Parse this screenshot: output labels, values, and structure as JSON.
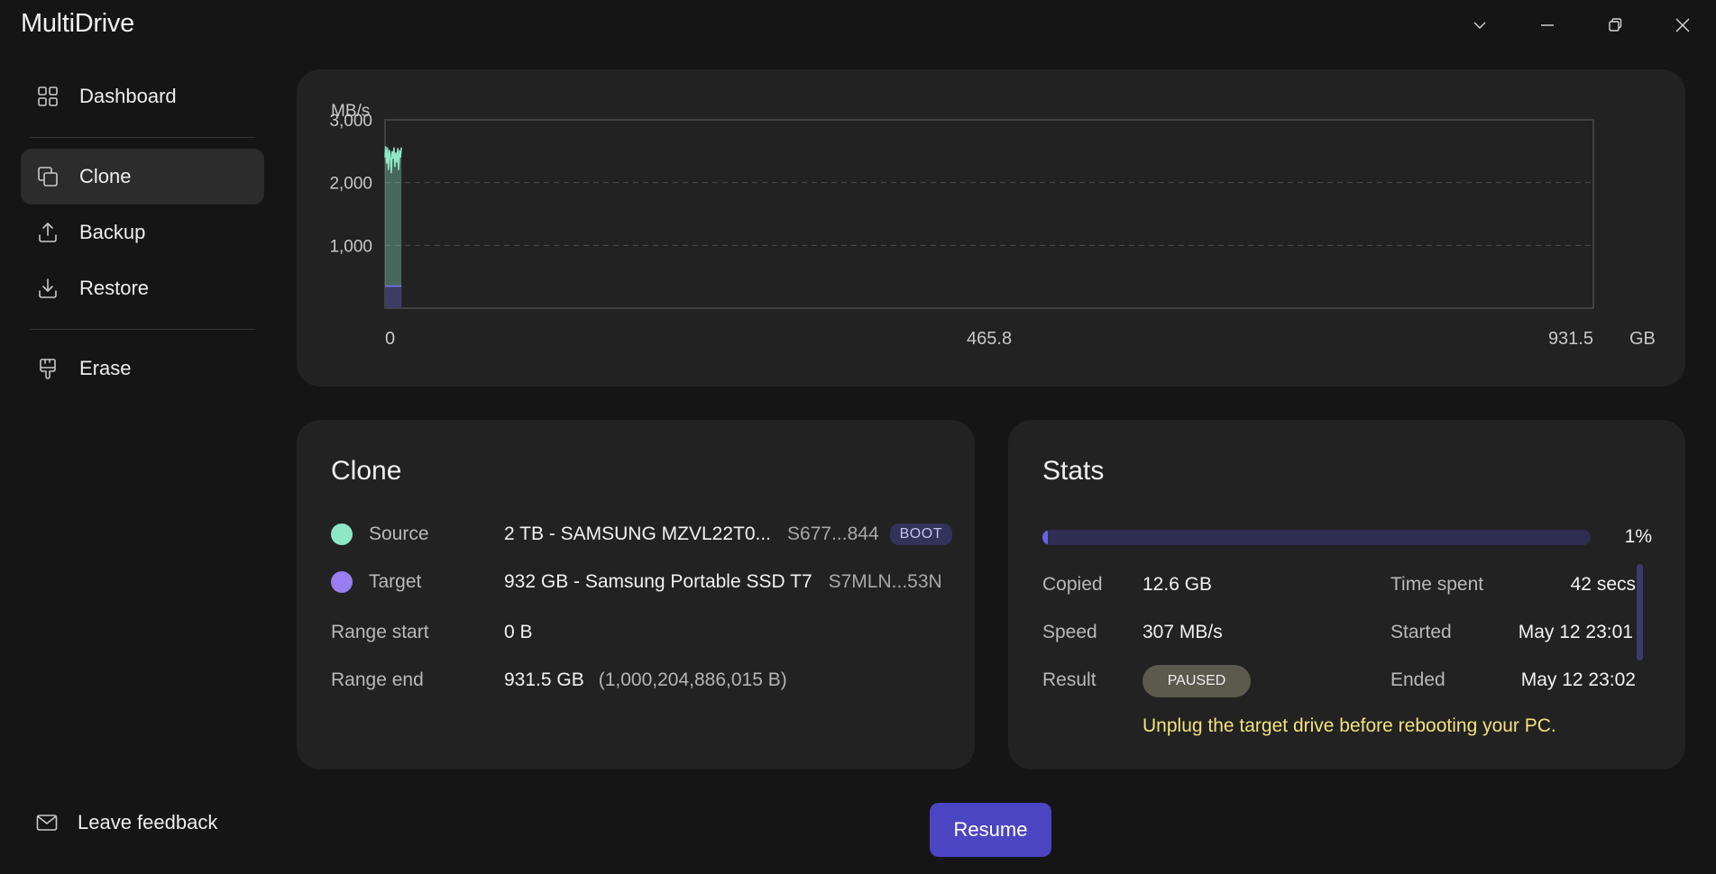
{
  "app": {
    "title": "MultiDrive"
  },
  "window_controls": [
    "chevron-down-icon",
    "minimize-icon",
    "restore-icon",
    "close-icon"
  ],
  "sidebar": {
    "items": [
      {
        "label": "Dashboard",
        "icon": "dashboard-icon",
        "active": false
      },
      {
        "label": "Clone",
        "icon": "clone-icon",
        "active": true
      },
      {
        "label": "Backup",
        "icon": "upload-icon",
        "active": false
      },
      {
        "label": "Restore",
        "icon": "download-icon",
        "active": false
      },
      {
        "label": "Erase",
        "icon": "brush-icon",
        "active": false
      }
    ],
    "feedback": {
      "label": "Leave feedback",
      "icon": "mail-icon"
    }
  },
  "chart_data": {
    "type": "area",
    "ylabel": "MB/s",
    "xlabel": "GB",
    "yticks": [
      "3,000",
      "2,000",
      "1,000"
    ],
    "xticks": [
      "0",
      "465.8",
      "931.5"
    ],
    "ylim": [
      0,
      3000
    ],
    "xlim": [
      0,
      931.5
    ],
    "grid": true,
    "series": [
      {
        "color": "#8ee8c8",
        "x": [
          0,
          0.5,
          1.2,
          1.9,
          2.6,
          3.3,
          4.0,
          4.8,
          5.5,
          6.2,
          6.9,
          7.6,
          8.3,
          9.0,
          9.8,
          10.5,
          11.2,
          11.9,
          12.6
        ],
        "values": [
          2400,
          2580,
          2300,
          2560,
          2200,
          2520,
          2450,
          2150,
          2500,
          2380,
          2560,
          2250,
          2480,
          2320,
          2550,
          2200,
          2520,
          2400,
          2560
        ]
      },
      {
        "color": "#7b72e8",
        "x": [
          0,
          12.6
        ],
        "values": [
          350,
          350
        ]
      }
    ]
  },
  "clone": {
    "title": "Clone",
    "source": {
      "label": "Source",
      "drive": "2 TB - SAMSUNG MZVL22T0...",
      "serial": "S677...844",
      "badge": "BOOT",
      "color": "#8ee8c8"
    },
    "target": {
      "label": "Target",
      "drive": "932 GB - Samsung Portable SSD T7",
      "serial": "S7MLN...53N",
      "color": "#9a7df0"
    },
    "range_start": {
      "label": "Range start",
      "value": "0 B"
    },
    "range_end": {
      "label": "Range end",
      "value": "931.5 GB",
      "bytes": "(1,000,204,886,015 B)"
    }
  },
  "stats": {
    "title": "Stats",
    "progress_fraction": 0.01,
    "progress_label": "1%",
    "copied": {
      "label": "Copied",
      "value": "12.6 GB"
    },
    "speed": {
      "label": "Speed",
      "value": "307 MB/s"
    },
    "result": {
      "label": "Result",
      "value": "PAUSED"
    },
    "time_spent": {
      "label": "Time spent",
      "value": "42 secs"
    },
    "started": {
      "label": "Started",
      "value": "May 12 23:01"
    },
    "ended": {
      "label": "Ended",
      "value": "May 12 23:02"
    },
    "warning": "Unplug the target drive before rebooting your PC."
  },
  "actions": {
    "resume": "Resume"
  }
}
